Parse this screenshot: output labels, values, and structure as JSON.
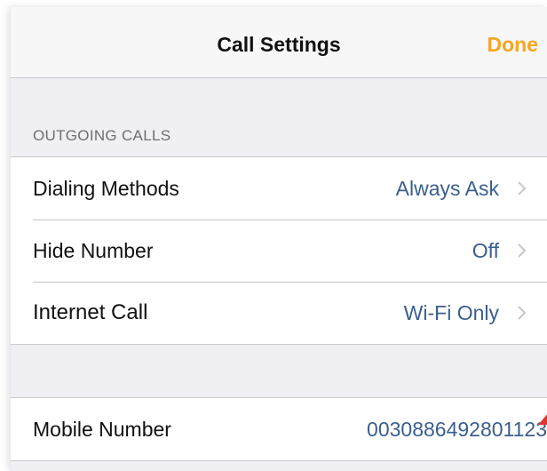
{
  "nav": {
    "title": "Call Settings",
    "done_label": "Done"
  },
  "outgoing": {
    "header": "OUTGOING CALLS",
    "rows": [
      {
        "label": "Dialing Methods",
        "value": "Always Ask",
        "icon": "chevron-right-icon"
      },
      {
        "label": "Hide Number",
        "value": "Off",
        "icon": "chevron-right-icon"
      },
      {
        "label": "Internet Call",
        "value": "Wi-Fi Only",
        "icon": "chevron-right-icon"
      }
    ]
  },
  "mobile": {
    "label": "Mobile Number",
    "value": "0030886492801123"
  },
  "colors": {
    "accent": "#f5a623",
    "value_text": "#3a5f8f",
    "background": "#efeff4"
  }
}
